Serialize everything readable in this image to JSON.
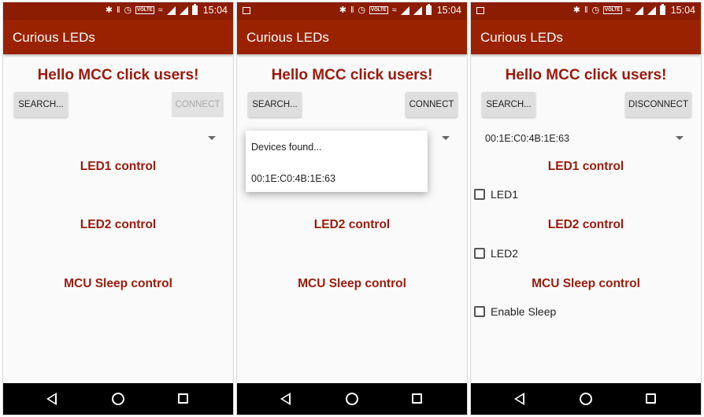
{
  "status_bar": {
    "time": "15:04",
    "volte_label": "VOLTE"
  },
  "app": {
    "title": "Curious LEDs",
    "greeting": "Hello MCC click users!"
  },
  "sections": {
    "led1": "LED1 control",
    "led2": "LED2 control",
    "mcu_sleep": "MCU Sleep control"
  },
  "screens": [
    {
      "search_label": "SEARCH...",
      "connect_label": "CONNECT",
      "connect_enabled": false,
      "selected_device": ""
    },
    {
      "search_label": "SEARCH...",
      "connect_label": "CONNECT",
      "connect_enabled": true,
      "popup": {
        "title": "Devices found...",
        "items": [
          "00:1E:C0:4B:1E:63"
        ]
      }
    },
    {
      "search_label": "SEARCH...",
      "disconnect_label": "DISCONNECT",
      "selected_device": "00:1E:C0:4B:1E:63",
      "checkboxes": [
        {
          "label": "LED1",
          "checked": false
        },
        {
          "label": "LED2",
          "checked": false
        },
        {
          "label": "Enable Sleep",
          "checked": false
        }
      ]
    }
  ],
  "icons": {
    "status": [
      "bluetooth-icon",
      "vibrate-icon",
      "alarm-icon",
      "volte-icon",
      "wifi-calling-icon",
      "signal-icon",
      "signal-icon",
      "battery-icon"
    ],
    "nav": [
      "back-icon",
      "home-icon",
      "recents-icon"
    ]
  },
  "colors": {
    "status_bar": "#8c1c02",
    "app_bar": "#9a2200",
    "accent_text": "#9a1a0c",
    "nav_bar": "#000000"
  }
}
